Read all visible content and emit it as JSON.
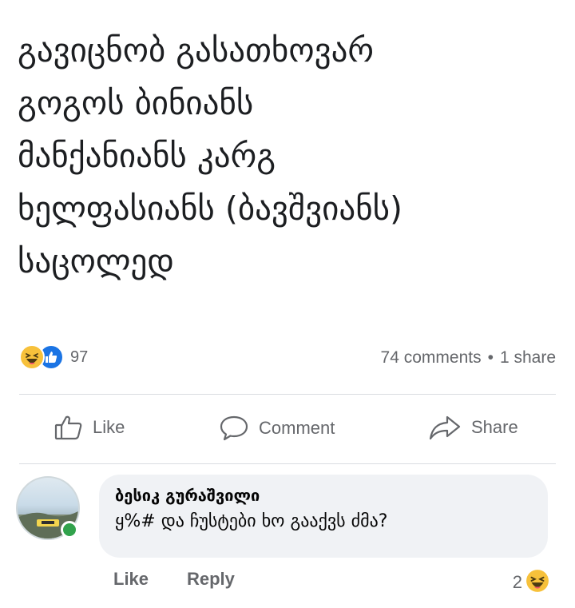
{
  "post": {
    "lines": [
      "გავიცნობ გასათხოვარ",
      "გოგოს ბინიანს",
      "მანქანიანს კარგ",
      "ხელფასიანს (ბავშვიანს)",
      "საცოლედ"
    ]
  },
  "stats": {
    "reaction_icons": [
      "haha-icon",
      "like-icon"
    ],
    "reactions_count": "97",
    "comments": "74 comments",
    "separator": "•",
    "shares": "1 share"
  },
  "actions": {
    "like": "Like",
    "comment": "Comment",
    "share": "Share"
  },
  "comment": {
    "author": "ბესიკ გურაშვილი",
    "text": "ყ%# და ჩუსტები ხო გააქვს ძმა?",
    "like_label": "Like",
    "reply_label": "Reply",
    "reaction_count": "2",
    "reaction_icon": "haha-icon"
  },
  "colors": {
    "accent": "#1b74e4",
    "haha": "#f7c13b",
    "online": "#31a24c",
    "muted_text": "#65676b",
    "bubble": "#f0f2f5"
  }
}
